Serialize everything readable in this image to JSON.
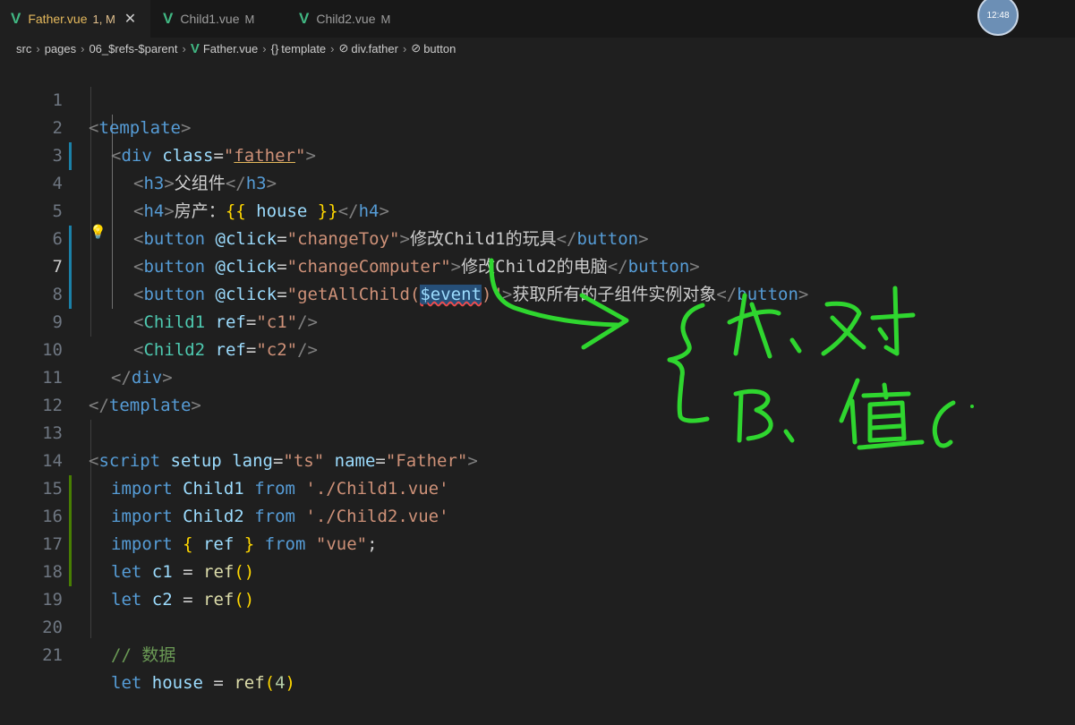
{
  "tabs": [
    {
      "label": "Father.vue",
      "status": "1, M",
      "active": true
    },
    {
      "label": "Child1.vue",
      "status": "M",
      "active": false
    },
    {
      "label": "Child2.vue",
      "status": "M",
      "active": false
    }
  ],
  "avatar_text": "12:48",
  "breadcrumb": {
    "items": [
      "src",
      "pages",
      "06_$refs-$parent",
      "Father.vue",
      "template",
      "div.father",
      "button"
    ]
  },
  "editor": {
    "current_line": 7,
    "lines": [
      {
        "n": "1"
      },
      {
        "n": "2"
      },
      {
        "n": "3"
      },
      {
        "n": "4"
      },
      {
        "n": "5"
      },
      {
        "n": "6"
      },
      {
        "n": "7"
      },
      {
        "n": "8"
      },
      {
        "n": "9"
      },
      {
        "n": "10"
      },
      {
        "n": "11"
      },
      {
        "n": "12"
      },
      {
        "n": "13"
      },
      {
        "n": "14"
      },
      {
        "n": "15"
      },
      {
        "n": "16"
      },
      {
        "n": "17"
      },
      {
        "n": "18"
      },
      {
        "n": "19"
      },
      {
        "n": "20"
      },
      {
        "n": "21"
      }
    ],
    "code": {
      "l1": {
        "t1": "<",
        "tag": "template",
        "t2": ">"
      },
      "l2": {
        "t1": "<",
        "tag": "div",
        "attr": "class",
        "eq": "=",
        "q1": "\"",
        "val": "father",
        "q2": "\"",
        "t2": ">"
      },
      "l3": {
        "t1": "<",
        "tag": "h3",
        "t2": ">",
        "text": "父组件",
        "t3": "</",
        "tag2": "h3",
        "t4": ">"
      },
      "l4": {
        "t1": "<",
        "tag": "h4",
        "t2": ">",
        "text": "房产：",
        "b1": "{{",
        "var": " house ",
        "b2": "}}",
        "t3": "</",
        "tag2": "h4",
        "t4": ">"
      },
      "l5": {
        "t1": "<",
        "tag": "button",
        "attr": "@click",
        "eq": "=",
        "val": "\"changeToy\"",
        "t2": ">",
        "text": "修改Child1的玩具",
        "t3": "</",
        "tag2": "button",
        "t4": ">"
      },
      "l6": {
        "t1": "<",
        "tag": "button",
        "attr": "@click",
        "eq": "=",
        "val": "\"changeComputer\"",
        "t2": ">",
        "text": "修改Child2的电脑",
        "t3": "</",
        "tag2": "button",
        "t4": ">"
      },
      "l7": {
        "t1": "<",
        "tag": "button",
        "attr": "@click",
        "eq": "=",
        "val1": "\"getAllChild(",
        "sel": "$event",
        "val2": ")\"",
        "t2": ">",
        "text": "获取所有的子组件实例对象",
        "t3": "</",
        "tag2": "button",
        "t4": ">"
      },
      "l8": {
        "t1": "<",
        "tag": "Child1",
        "attr": "ref",
        "eq": "=",
        "val": "\"c1\"",
        "t2": "/>"
      },
      "l9": {
        "t1": "<",
        "tag": "Child2",
        "attr": "ref",
        "eq": "=",
        "val": "\"c2\"",
        "t2": "/>"
      },
      "l10": {
        "t1": "</",
        "tag": "div",
        "t2": ">"
      },
      "l11": {
        "t1": "</",
        "tag": "template",
        "t2": ">"
      },
      "l13": {
        "t1": "<",
        "tag": "script",
        "a1": "setup",
        "a2": "lang",
        "eq": "=",
        "v2": "\"ts\"",
        "a3": "name",
        "v3": "\"Father\"",
        "t2": ">"
      },
      "l14": {
        "kw": "import",
        "id": "Child1",
        "kw2": "from",
        "str": "'./Child1.vue'"
      },
      "l15": {
        "kw": "import",
        "id": "Child2",
        "kw2": "from",
        "str": "'./Child2.vue'"
      },
      "l16": {
        "kw": "import",
        "b1": "{",
        "id": " ref ",
        "b2": "}",
        "kw2": "from",
        "str": "\"vue\"",
        "semi": ";"
      },
      "l17": {
        "kw": "let",
        "id": "c1",
        "op": " = ",
        "fn": "ref",
        "p": "()"
      },
      "l18": {
        "kw": "let",
        "id": "c2",
        "op": " = ",
        "fn": "ref",
        "p": "()"
      },
      "l20": {
        "comment": "// 数据"
      },
      "l21": {
        "kw": "let",
        "id": "house",
        "op": " = ",
        "fn": "ref",
        "p1": "(",
        "num": "4",
        "p2": ")"
      }
    }
  },
  "colors": {
    "annotation_ink": "#2fd62f",
    "accent": "#41b883"
  }
}
